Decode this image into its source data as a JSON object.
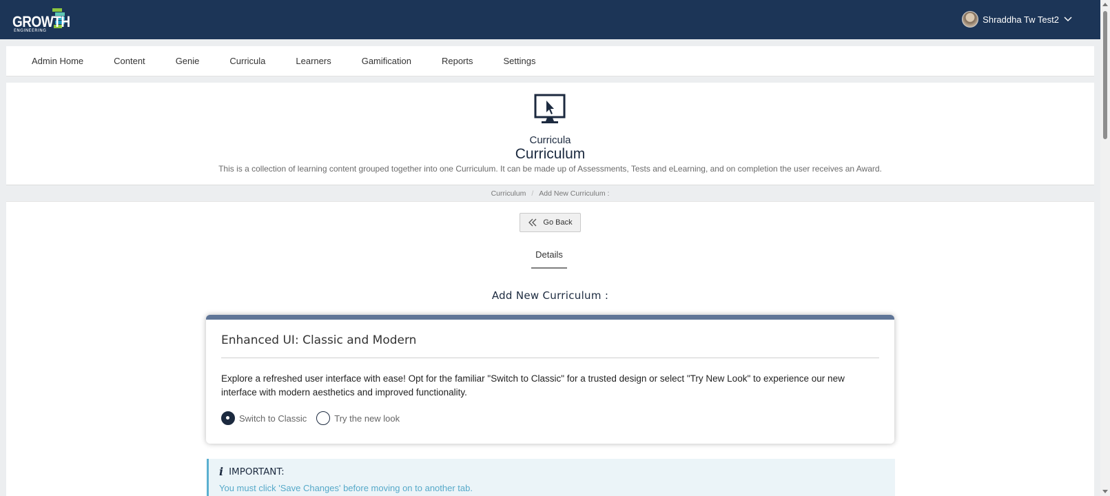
{
  "logo": {
    "text": "GROWTH",
    "subtext": "ENGINEERING"
  },
  "user": {
    "name": "Shraddha Tw Test2"
  },
  "nav": {
    "items": [
      {
        "label": "Admin Home"
      },
      {
        "label": "Content"
      },
      {
        "label": "Genie"
      },
      {
        "label": "Curricula"
      },
      {
        "label": "Learners"
      },
      {
        "label": "Gamification"
      },
      {
        "label": "Reports"
      },
      {
        "label": "Settings"
      }
    ]
  },
  "header": {
    "category": "Curricula",
    "title": "Curriculum",
    "description": "This is a collection of learning content grouped together into one Curriculum. It can be made up of Assessments, Tests and eLearning, and on completion the user receives an Award."
  },
  "breadcrumb": {
    "items": [
      "Curriculum",
      "Add New Curriculum :"
    ],
    "separator": "/"
  },
  "main": {
    "go_back_label": "Go Back",
    "tab_details": "Details",
    "section_title": "Add New Curriculum :",
    "card": {
      "title": "Enhanced UI: Classic and Modern",
      "text": "Explore a refreshed user interface with ease! Opt for the familiar \"Switch to Classic\" for a trusted design or select \"Try New Look\" to experience our new interface with modern aesthetics and improved functionality.",
      "options": [
        {
          "label": "Switch to Classic",
          "selected": true
        },
        {
          "label": "Try the new look",
          "selected": false
        }
      ]
    },
    "important": {
      "title": "IMPORTANT:",
      "text": "You must click 'Save Changes' before moving on to another tab."
    }
  },
  "colors": {
    "topbar": "#1c3557",
    "card_accent": "#5f7597",
    "important_border": "#5bb0d0",
    "important_text": "#56a9c9"
  }
}
